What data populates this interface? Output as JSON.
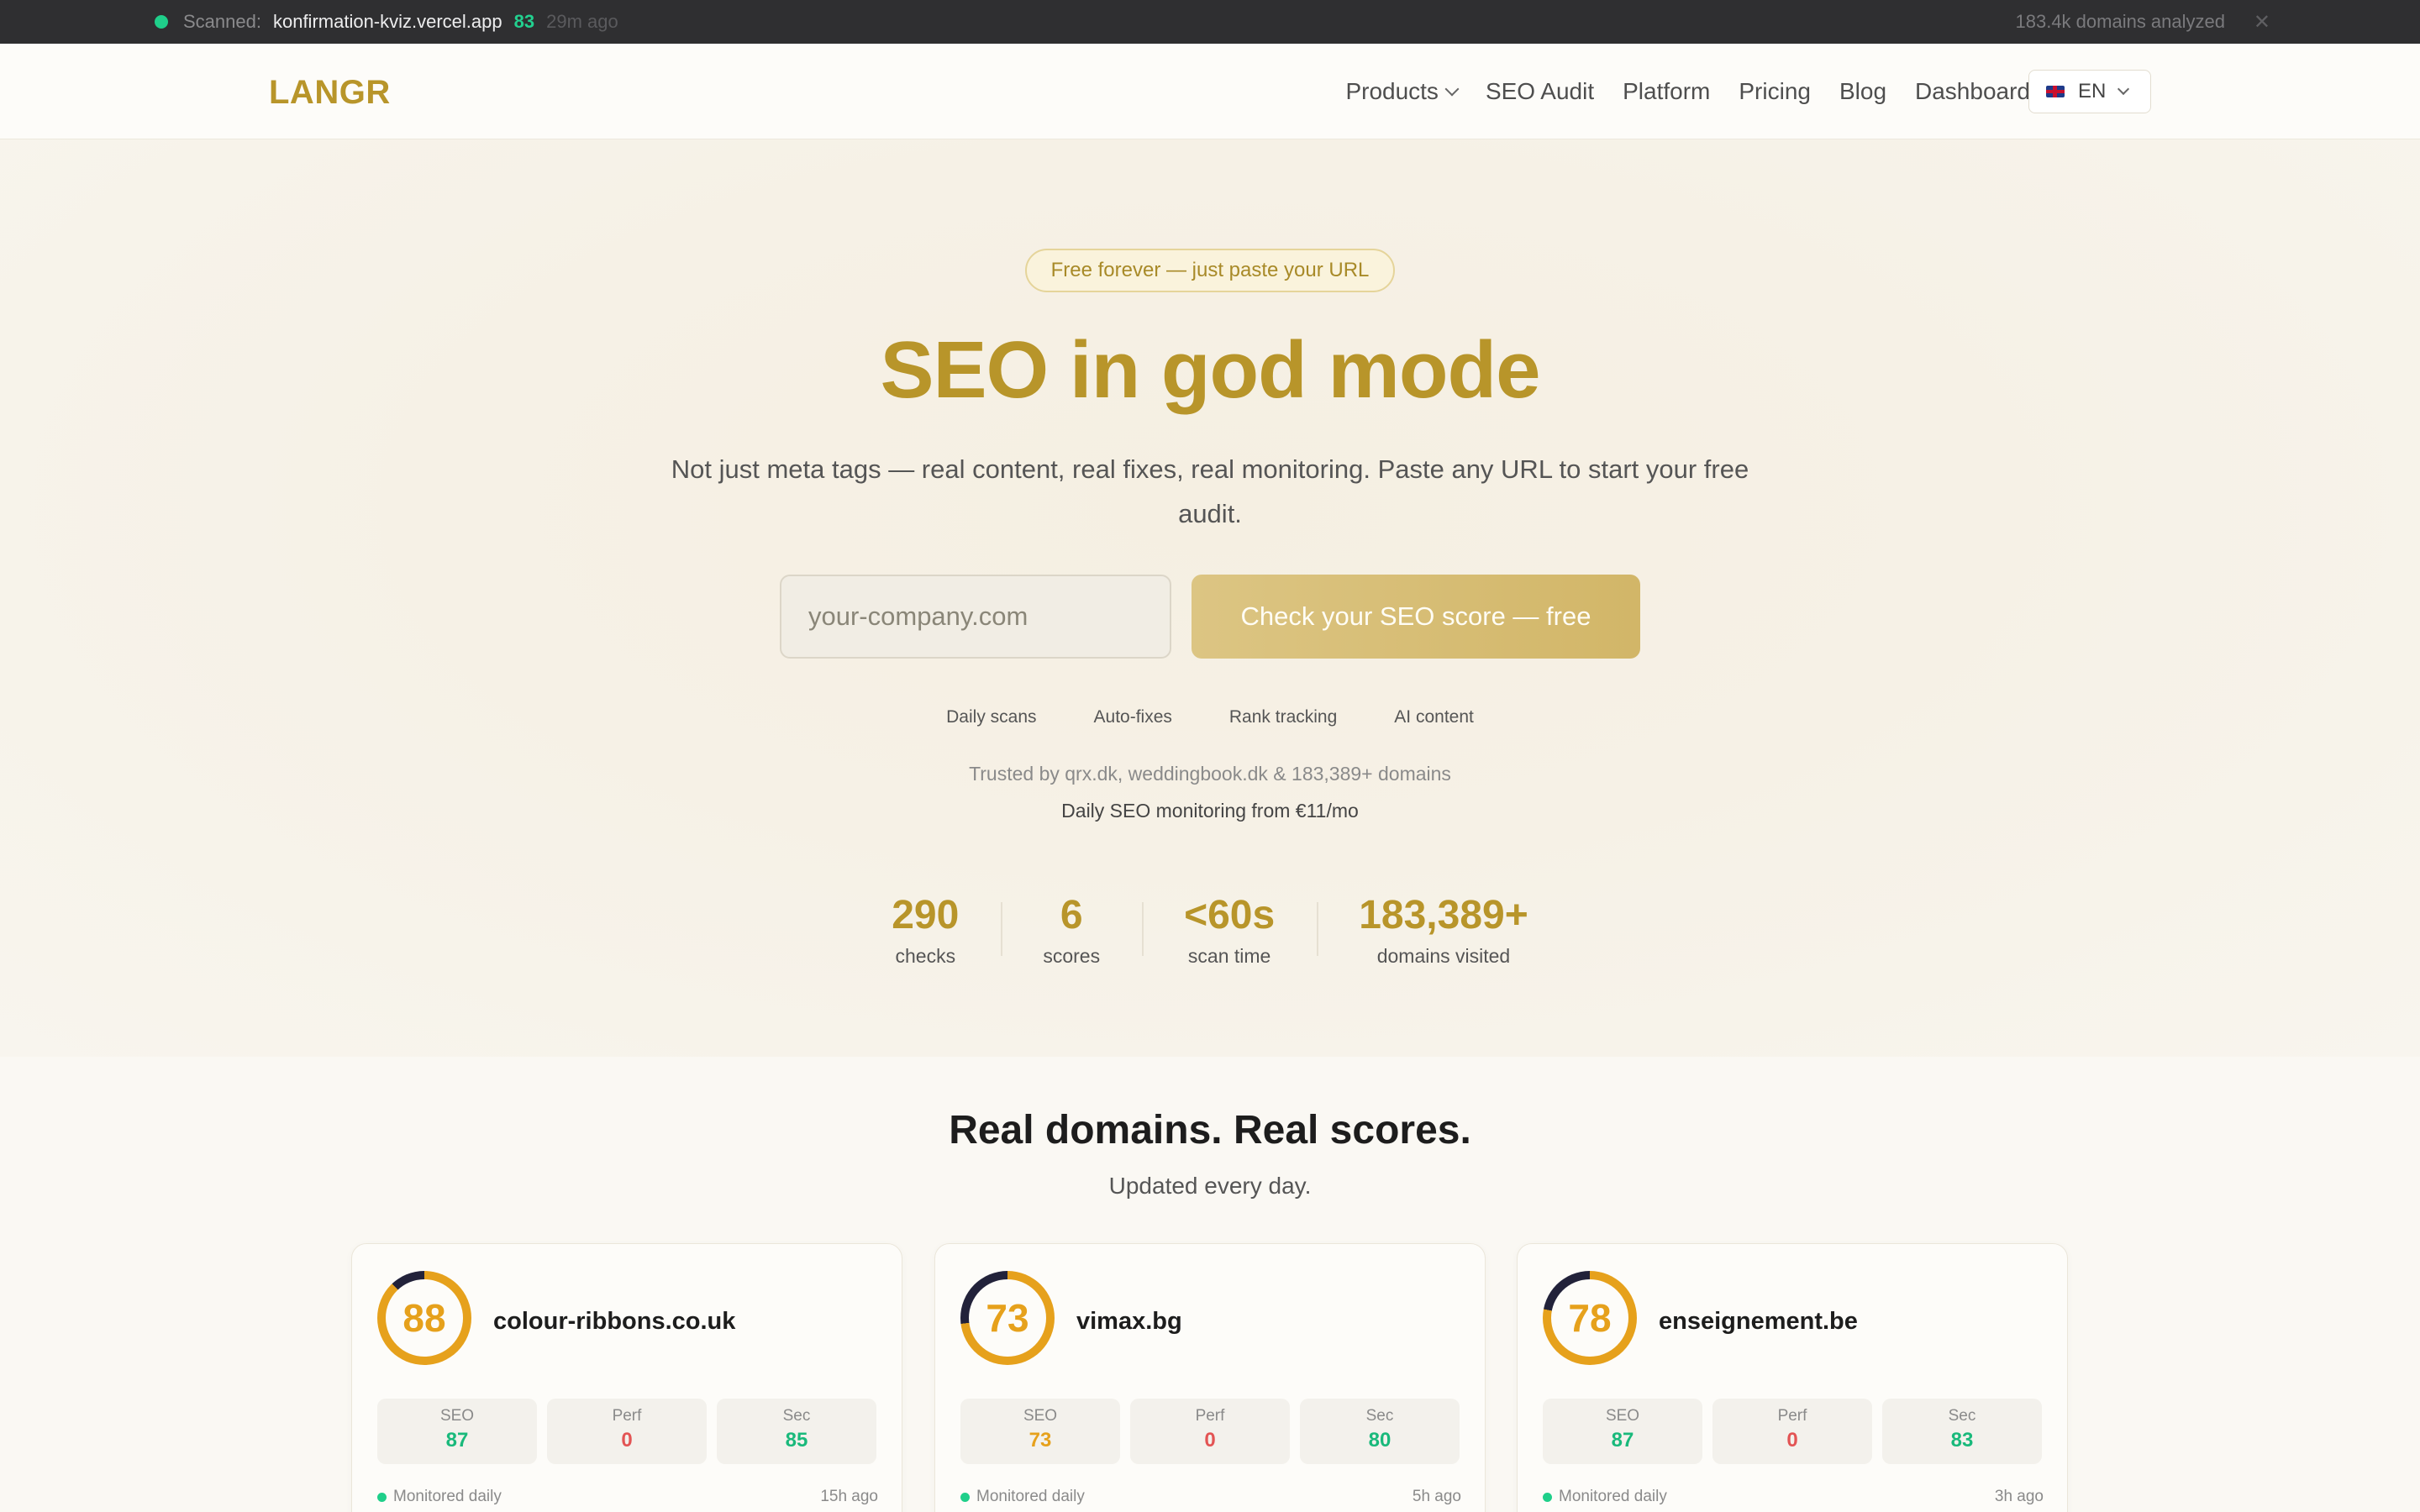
{
  "scanbar": {
    "label": "Scanned:",
    "domain": "konfirmation-kviz.vercel.app",
    "score": "83",
    "ago": "29m ago",
    "domains_analyzed": "183.4k domains analyzed",
    "close_glyph": "✕",
    "status_color": "#1fcf8a"
  },
  "nav": {
    "logo": "LANGR",
    "links": [
      "Products",
      "SEO Audit",
      "Platform",
      "Pricing",
      "Blog",
      "Dashboard"
    ],
    "language": "EN",
    "brand_color": "#b8952a"
  },
  "hero": {
    "badge": "Free forever — just paste your URL",
    "headline": "SEO in god mode",
    "subtitle": "Not just meta tags — real content, real fixes, real monitoring. Paste any URL to start your free audit.",
    "input_placeholder": "your-company.com",
    "cta": "Check your SEO score — free",
    "features": [
      "Daily scans",
      "Auto-fixes",
      "Rank tracking",
      "AI content"
    ],
    "trusted": "Trusted by qrx.dk, weddingbook.dk & 183,389+ domains",
    "pricing": "Daily SEO monitoring from €11/mo",
    "stats": [
      {
        "num": "290",
        "cap": "checks"
      },
      {
        "num": "6",
        "cap": "scores"
      },
      {
        "num": "<60s",
        "cap": "scan time"
      },
      {
        "num": "183,389+",
        "cap": "domains visited"
      }
    ]
  },
  "domains": {
    "title": "Real domains. Real scores.",
    "subtitle": "Updated every day.",
    "cards": [
      {
        "score": "88",
        "score_value": 88,
        "name": "colour-ribbons.co.uk",
        "seo": "87",
        "perf": "0",
        "sec": "85",
        "status": "Monitored daily",
        "ago": "15h ago"
      },
      {
        "score": "73",
        "score_value": 73,
        "name": "vimax.bg",
        "seo": "73",
        "perf": "0",
        "sec": "80",
        "status": "Monitored daily",
        "ago": "5h ago"
      },
      {
        "score": "78",
        "score_value": 78,
        "name": "enseignement.be",
        "seo": "87",
        "perf": "0",
        "sec": "83",
        "status": "Monitored daily",
        "ago": "3h ago"
      }
    ],
    "metric_labels": {
      "seo": "SEO",
      "perf": "Perf",
      "sec": "Sec"
    }
  }
}
